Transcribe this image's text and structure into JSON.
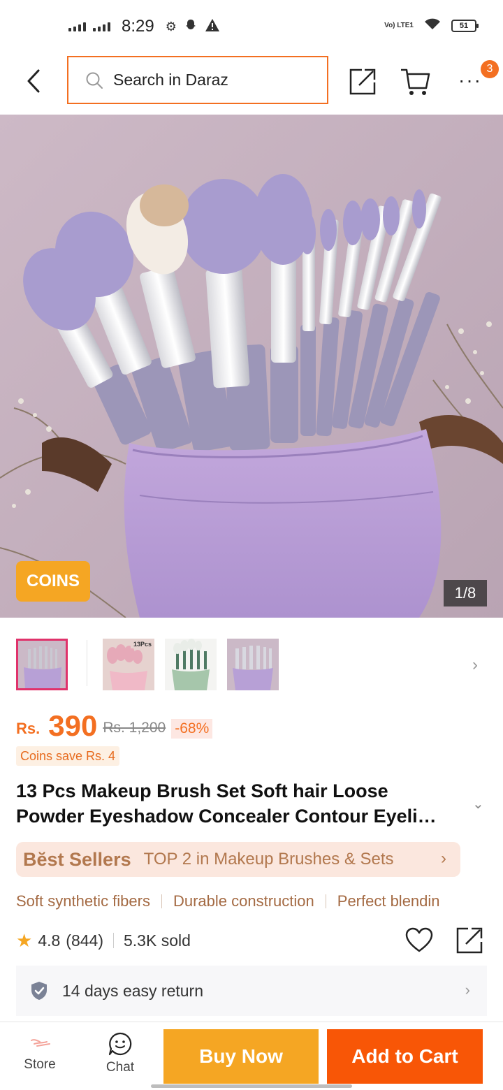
{
  "status_bar": {
    "time": "8:29",
    "network_label": "Vo) LTE1",
    "battery": "51"
  },
  "search": {
    "placeholder": "Search in Daraz"
  },
  "header": {
    "notification_count": "3"
  },
  "gallery": {
    "coins_badge": "COINS",
    "counter": "1/8",
    "thumb_2_label": "13Pcs"
  },
  "price": {
    "currency": "Rs.",
    "current": "390",
    "original": "Rs. 1,200",
    "discount": "-68%",
    "coins_save": "Coins save Rs. 4"
  },
  "product": {
    "title_line1": "13 Pcs Makeup Brush Set Soft hair Loose",
    "title_line2": "Powder Eyeshadow Concealer Contour Eyeli…"
  },
  "best_sellers": {
    "logo": "Bĕst Sellers",
    "text": "TOP 2 in Makeup Brushes & Sets"
  },
  "features": [
    "Soft synthetic fibers",
    "Durable construction",
    "Perfect blendin"
  ],
  "rating": {
    "value": "4.8",
    "count": "(844)",
    "sold": "5.3K sold"
  },
  "return_policy": "14 days easy return",
  "bottom_bar": {
    "store_label": "Store",
    "chat_label": "Chat",
    "buy_now": "Buy Now",
    "add_to_cart": "Add to Cart"
  },
  "colors": {
    "brand_orange": "#f85606",
    "buy_yellow": "#f5a623",
    "price_orange": "#f36f21"
  }
}
